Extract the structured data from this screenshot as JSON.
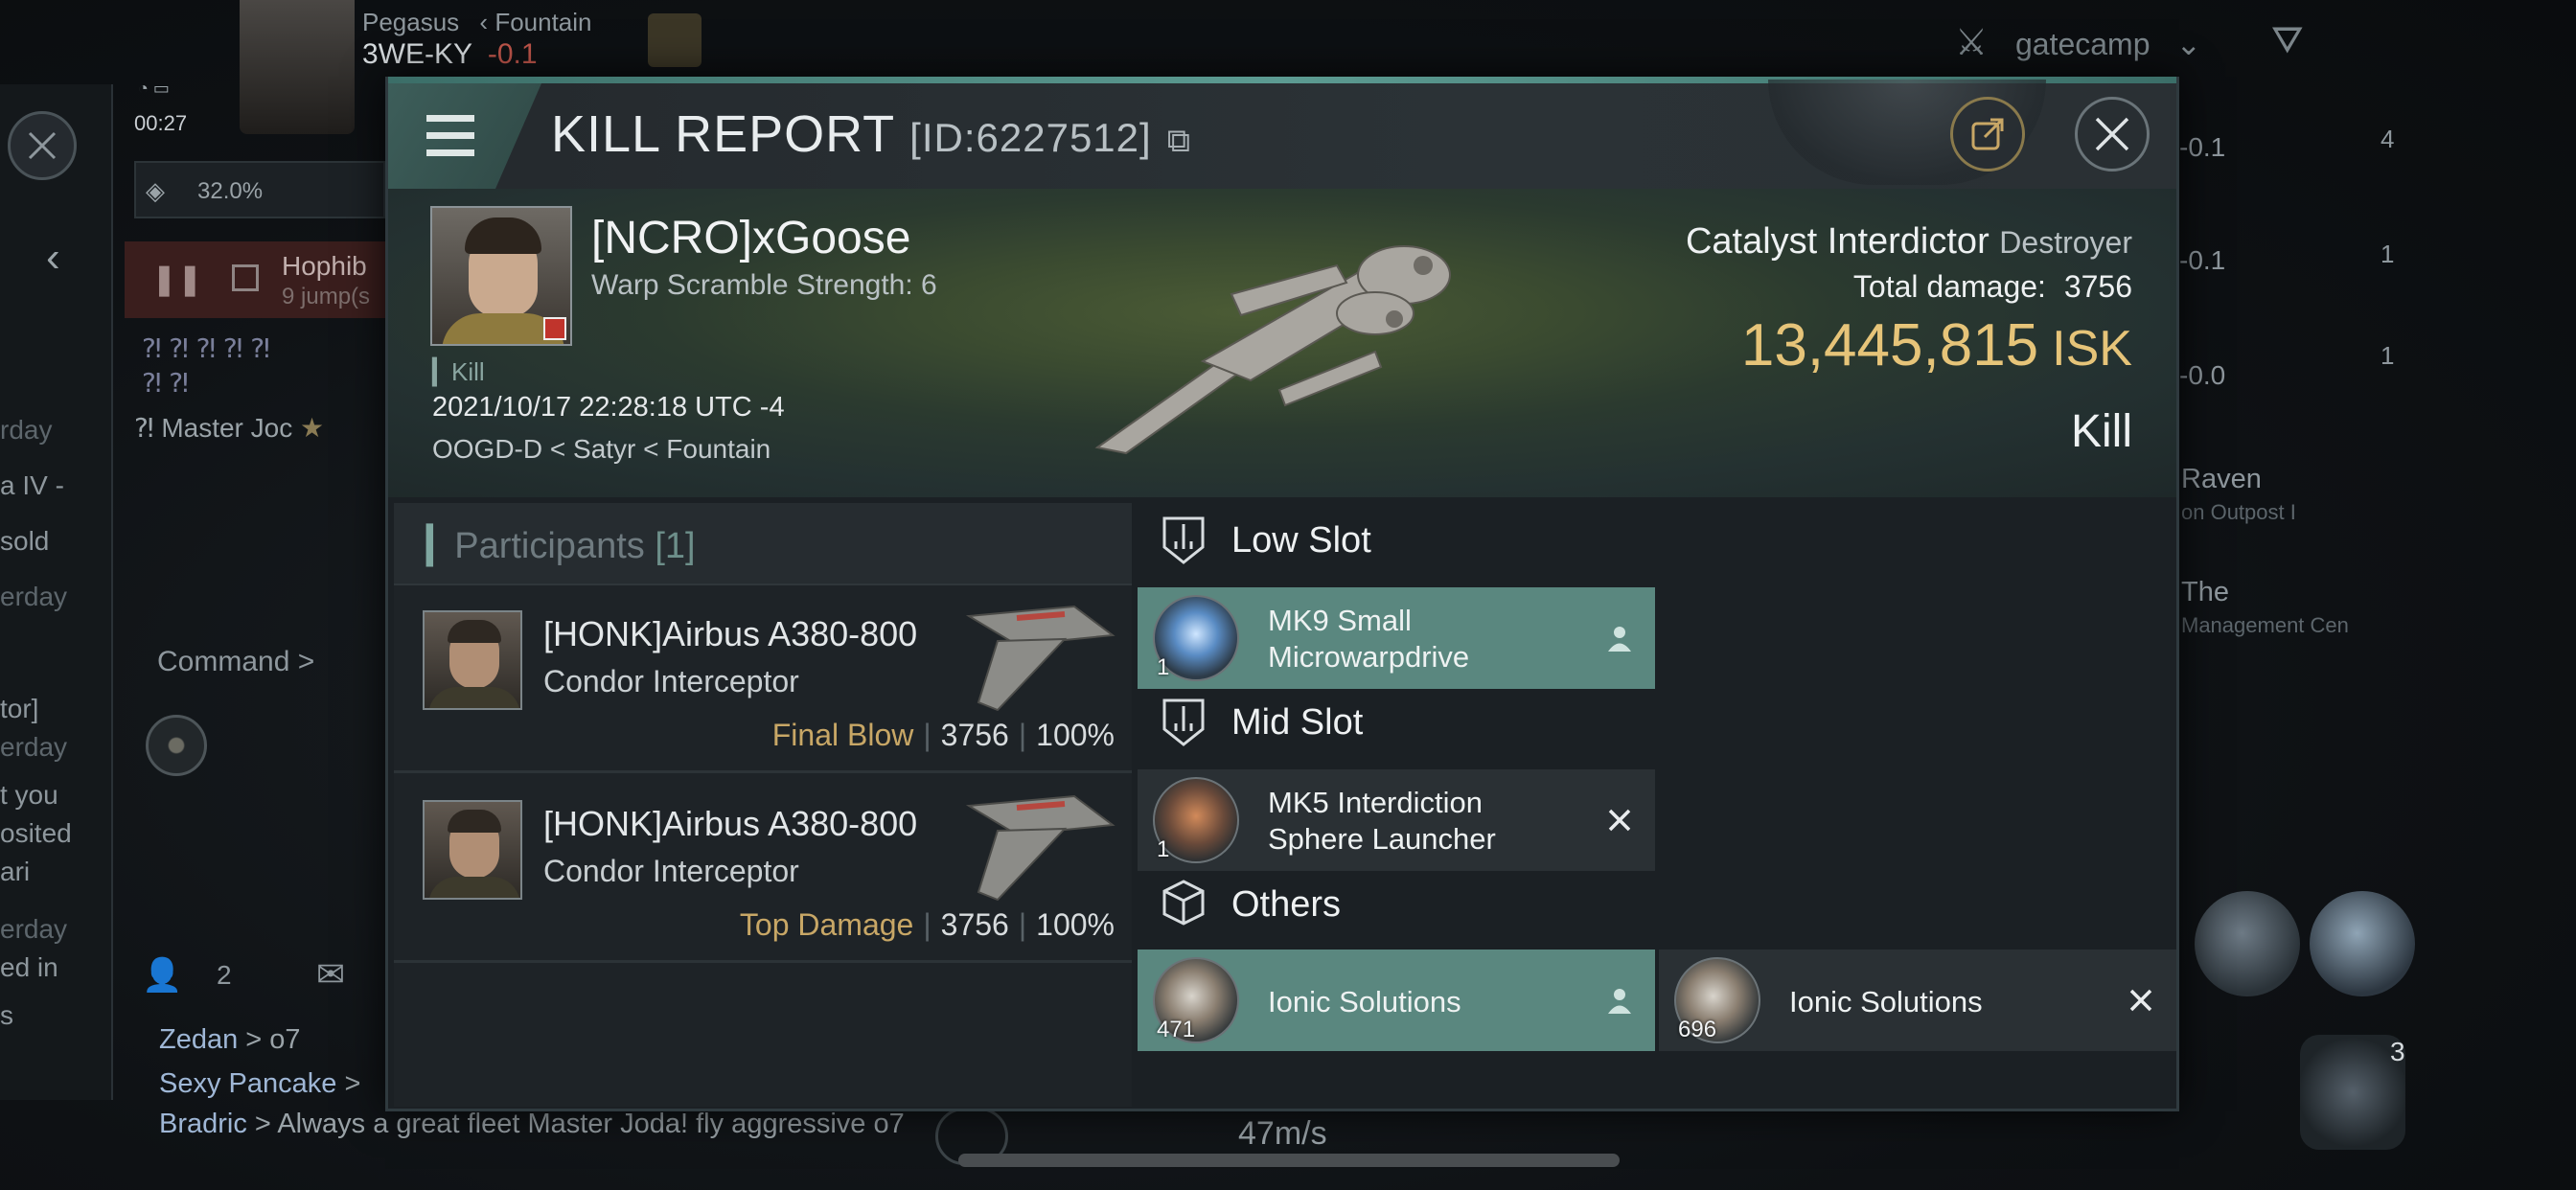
{
  "background": {
    "system": {
      "region_path": "Pegasus",
      "fountain": "Fountain",
      "name": "3WE-KY",
      "sec": "-0.1"
    },
    "timer": "00:27",
    "cargo_pct": "32.0%",
    "route": {
      "name": "Hophib",
      "jumps": "9 jump(s"
    },
    "master_name": "Master Joc",
    "command_label": "Command >",
    "chat_count": "2",
    "chat_lines": [
      {
        "who": "Zedan",
        "msg": "> o7"
      },
      {
        "who": "Sexy Pancake",
        "msg": "> "
      },
      {
        "who": "Bradric",
        "msg": "> Always a great fleet Master Joda! fly aggressive o7"
      }
    ],
    "left_fragments": [
      "rday",
      "a IV -",
      "sold",
      "erday",
      "tor]",
      "erday",
      "t you",
      "osited",
      "ari",
      "erday",
      "ed in",
      "s"
    ],
    "right_fragments": [
      {
        "text": "-0.1",
        "count": "4"
      },
      {
        "text": "-0.1",
        "count": "1"
      },
      {
        "text": "-0.0",
        "count": "1"
      }
    ],
    "right_texts": [
      "Raven",
      "on Outpost I",
      "The",
      "Management Cen"
    ],
    "filter_label": "gatecamp",
    "speed": "47m/s",
    "drone_count": "3"
  },
  "modal": {
    "title": "KILL REPORT",
    "report_id": "[ID:6227512]",
    "victim": {
      "name": "[NCRO]xGoose",
      "warp_scramble": "Warp Scramble Strength: 6",
      "kill_tag": "Kill",
      "datetime": "2021/10/17 22:28:18 UTC -4",
      "location": "OOGD-D < Satyr < Fountain",
      "ship": "Catalyst Interdictor",
      "ship_class": "Destroyer",
      "total_damage_label": "Total damage:",
      "total_damage": "3756",
      "isk_value": "13,445,815",
      "isk_unit": "ISK",
      "result": "Kill"
    },
    "participants": {
      "title": "Participants",
      "count": "[1]",
      "rows": [
        {
          "name": "[HONK]Airbus A380-800",
          "ship": "Condor Interceptor",
          "tag": "Final Blow",
          "damage": "3756",
          "pct": "100%"
        },
        {
          "name": "[HONK]Airbus A380-800",
          "ship": "Condor Interceptor",
          "tag": "Top Damage",
          "damage": "3756",
          "pct": "100%"
        }
      ]
    },
    "slots": {
      "low": {
        "label": "Low Slot",
        "items": [
          {
            "name_l1": "MK9 Small",
            "name_l2": "Microwarpdrive",
            "qty": "1",
            "status": "dropped"
          }
        ]
      },
      "mid": {
        "label": "Mid Slot",
        "items": [
          {
            "name_l1": "MK5 Interdiction",
            "name_l2": "Sphere Launcher",
            "qty": "1",
            "status": "destroyed"
          }
        ]
      },
      "others": {
        "label": "Others",
        "items": [
          {
            "name": "Ionic Solutions",
            "qty": "471",
            "status": "dropped"
          },
          {
            "name": "Ionic Solutions",
            "qty": "696",
            "status": "destroyed"
          }
        ]
      }
    }
  },
  "colors": {
    "accent_teal": "#5a877f",
    "isk_gold": "#e6c479",
    "tag_gold": "#c8a766"
  }
}
